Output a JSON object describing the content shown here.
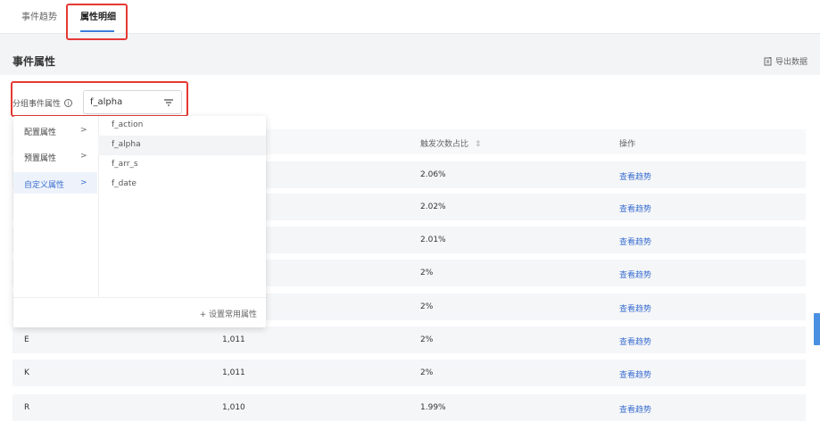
{
  "tabs": {
    "event_trend": "事件趋势",
    "attr_detail": "属性明细"
  },
  "section": {
    "title": "事件属性",
    "export_label": "导出数据"
  },
  "filter": {
    "label": "分组事件属性",
    "info_glyph": "i",
    "selected": "f_alpha"
  },
  "table": {
    "headers": {
      "trigger_ratio": "触发次数占比",
      "sort_glyph": "⇕",
      "action": "操作"
    },
    "rows": [
      {
        "name": "",
        "count": "",
        "ratio": "2.06%",
        "action": "查看趋势"
      },
      {
        "name": "",
        "count": "",
        "ratio": "2.02%",
        "action": "查看趋势"
      },
      {
        "name": "",
        "count": "",
        "ratio": "2.01%",
        "action": "查看趋势"
      },
      {
        "name": "",
        "count": "",
        "ratio": "2%",
        "action": "查看趋势"
      },
      {
        "name": "",
        "count": "",
        "ratio": "2%",
        "action": "查看趋势"
      },
      {
        "name": "E",
        "count": "1,011",
        "ratio": "2%",
        "action": "查看趋势"
      },
      {
        "name": "K",
        "count": "1,011",
        "ratio": "2%",
        "action": "查看趋势"
      },
      {
        "name": "R",
        "count": "1,010",
        "ratio": "1.99%",
        "action": "查看趋势"
      }
    ]
  },
  "dropdown": {
    "categories": [
      {
        "label": "配置属性",
        "arrow": ">"
      },
      {
        "label": "预置属性",
        "arrow": ">"
      },
      {
        "label": "自定义属性",
        "arrow": ">"
      }
    ],
    "options": [
      "f_action",
      "f_alpha",
      "f_arr_s",
      "f_date"
    ],
    "footer": "+ 设置常用属性"
  },
  "colors": {
    "accent": "#3b7ddd",
    "highlight_box": "#e53935",
    "link": "#3b6fd0"
  },
  "icons": {
    "export": "export-icon",
    "filter": "filter-icon",
    "info": "info-icon"
  }
}
